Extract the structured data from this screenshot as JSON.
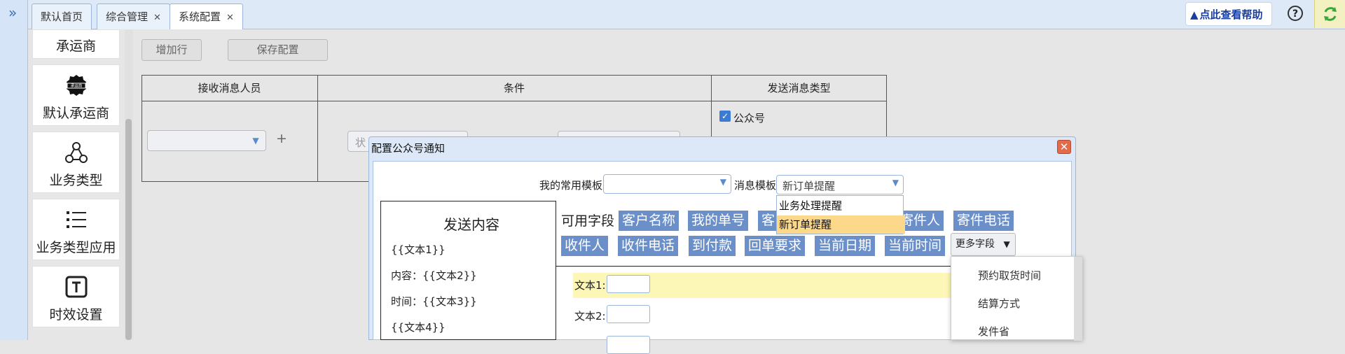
{
  "tabs": [
    {
      "label": "默认首页",
      "closable": false
    },
    {
      "label": "综合管理",
      "closable": true
    },
    {
      "label": "系统配置",
      "closable": true,
      "active": true
    }
  ],
  "topbar": {
    "expand_icon": "double-chevron-right-icon",
    "help_label": "点此查看帮助",
    "question_icon": "question-circle-icon",
    "reload_icon": "refresh-icon"
  },
  "sidebar": {
    "items": [
      {
        "label": "承运商",
        "icon": ""
      },
      {
        "label": "默认承运商",
        "icon": "carrier-badge-icon",
        "badge_text": "承运商"
      },
      {
        "label": "业务类型",
        "icon": "nodes-icon"
      },
      {
        "label": "业务类型应用",
        "icon": "list-icon"
      },
      {
        "label": "时效设置",
        "icon": "t-box-icon"
      }
    ]
  },
  "toolbar": {
    "add_row_label": "增加行",
    "save_label": "保存配置"
  },
  "grid": {
    "headers": [
      "接收消息人员",
      "条件",
      "发送消息类型"
    ],
    "plus": "+",
    "status_placeholder": "状",
    "checkbox_label": "公众号",
    "checkbox_checked": true
  },
  "dialog": {
    "title": "配置公众号通知",
    "close_icon": "close-icon",
    "common_template_label": "我的常用模板",
    "common_template_value": "",
    "message_template_label": "消息模板",
    "message_template_value": "新订单提醒",
    "template_options": [
      "业务处理提醒",
      "新订单提醒"
    ],
    "selected_option_index": 1,
    "send_content": {
      "title": "发送内容",
      "lines": [
        "{{文本1}}",
        "内容：{{文本2}}",
        "时间：{{文本3}}",
        "{{文本4}}"
      ]
    },
    "available_fields_label": "可用字段",
    "fields_row1": [
      "客户名称",
      "我的单号",
      "客",
      "寄件人",
      "寄件电话"
    ],
    "fields_row2": [
      "收件人",
      "收件电话",
      "到付款",
      "回单要求",
      "当前日期",
      "当前时间"
    ],
    "more_fields_label": "更多字段",
    "more_fields_options": [
      "预约取货时间",
      "结算方式",
      "发件省"
    ],
    "text_inputs": [
      {
        "label": "文本1:",
        "value": ""
      },
      {
        "label": "文本2:",
        "value": ""
      }
    ]
  }
}
